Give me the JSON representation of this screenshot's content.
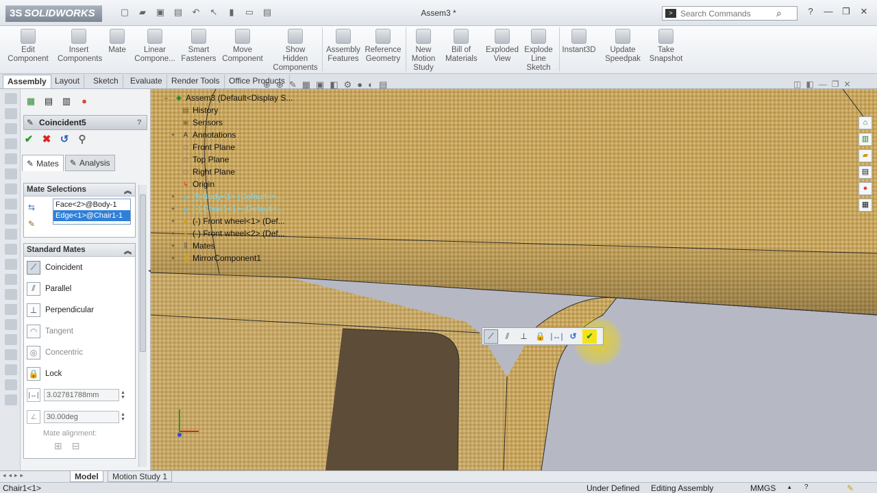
{
  "app": {
    "logo_ds": "3S",
    "logo_text": "SOLIDWORKS",
    "doc_title": "Assem3 *",
    "search_placeholder": "Search Commands"
  },
  "ribbon": [
    {
      "label": "Edit\nComponent"
    },
    {
      "label": "Insert\nComponents"
    },
    {
      "label": "Mate"
    },
    {
      "label": "Linear\nCompone..."
    },
    {
      "label": "Smart\nFasteners"
    },
    {
      "label": "Move\nComponent"
    },
    {
      "label": "Show\nHidden\nComponents"
    },
    {
      "label": "Assembly\nFeatures"
    },
    {
      "label": "Reference\nGeometry"
    },
    {
      "label": "New\nMotion\nStudy"
    },
    {
      "label": "Bill of\nMaterials"
    },
    {
      "label": "Exploded\nView"
    },
    {
      "label": "Explode\nLine\nSketch"
    },
    {
      "label": "Instant3D"
    },
    {
      "label": "Update\nSpeedpak"
    },
    {
      "label": "Take\nSnapshot"
    }
  ],
  "tabs": [
    "Assembly",
    "Layout",
    "Sketch",
    "Evaluate",
    "Render Tools",
    "Office Products"
  ],
  "property_manager": {
    "title": "Coincident5",
    "tabs": {
      "mates": "Mates",
      "analysis": "Analysis"
    },
    "mate_selections": {
      "header": "Mate Selections",
      "items": [
        "Face<2>@Body-1",
        "Edge<1>@Chair1-1"
      ]
    },
    "standard_mates": {
      "header": "Standard Mates",
      "items": [
        {
          "label": "Coincident",
          "icon": "coincident-icon",
          "active": true
        },
        {
          "label": "Parallel",
          "icon": "parallel-icon"
        },
        {
          "label": "Perpendicular",
          "icon": "perpendicular-icon"
        },
        {
          "label": "Tangent",
          "icon": "tangent-icon",
          "disabled": true
        },
        {
          "label": "Concentric",
          "icon": "concentric-icon",
          "disabled": true
        },
        {
          "label": "Lock",
          "icon": "lock-icon"
        }
      ],
      "distance_value": "3.02781788mm",
      "angle_value": "30.00deg",
      "alignment_label": "Mate alignment:"
    }
  },
  "feature_tree": [
    {
      "label": "Assem3  (Default<Display S...",
      "icon": "assembly-icon",
      "expand": "–",
      "indent": 0
    },
    {
      "label": "History",
      "icon": "history-icon",
      "expand": "",
      "indent": 1
    },
    {
      "label": "Sensors",
      "icon": "sensors-icon",
      "expand": "",
      "indent": 1
    },
    {
      "label": "Annotations",
      "icon": "annotations-icon",
      "expand": "+",
      "indent": 1
    },
    {
      "label": "Front Plane",
      "icon": "plane-icon",
      "expand": "",
      "indent": 1
    },
    {
      "label": "Top Plane",
      "icon": "plane-icon",
      "expand": "",
      "indent": 1
    },
    {
      "label": "Right Plane",
      "icon": "plane-icon",
      "expand": "",
      "indent": 1
    },
    {
      "label": "Origin",
      "icon": "origin-icon",
      "expand": "",
      "indent": 1
    },
    {
      "label": "(f) Body<1> (Default<<...",
      "icon": "part-icon",
      "expand": "+",
      "indent": 1,
      "dim": true
    },
    {
      "label": "(-) Chair1<1> (Default<...",
      "icon": "part-icon",
      "expand": "+",
      "indent": 1,
      "dim": true
    },
    {
      "label": "(-) Front wheel<1> (Def...",
      "icon": "part-icon",
      "expand": "+",
      "indent": 1
    },
    {
      "label": "(-) Front wheel<2> (Def...",
      "icon": "part-icon",
      "expand": "+",
      "indent": 1
    },
    {
      "label": "Mates",
      "icon": "mates-icon",
      "expand": "+",
      "indent": 1
    },
    {
      "label": "MirrorComponent1",
      "icon": "mirror-icon",
      "expand": "+",
      "indent": 1
    }
  ],
  "bottom_tabs": [
    "Model",
    "Motion Study 1"
  ],
  "status": {
    "left": "Chair1<1>",
    "state": "Under Defined",
    "mode": "Editing Assembly",
    "units": "MMGS"
  },
  "colors": {
    "fabric": "#c9a761",
    "dark_part": "#5a4a36",
    "selection": "#2f80d8",
    "highlight": "#f5e31a"
  }
}
